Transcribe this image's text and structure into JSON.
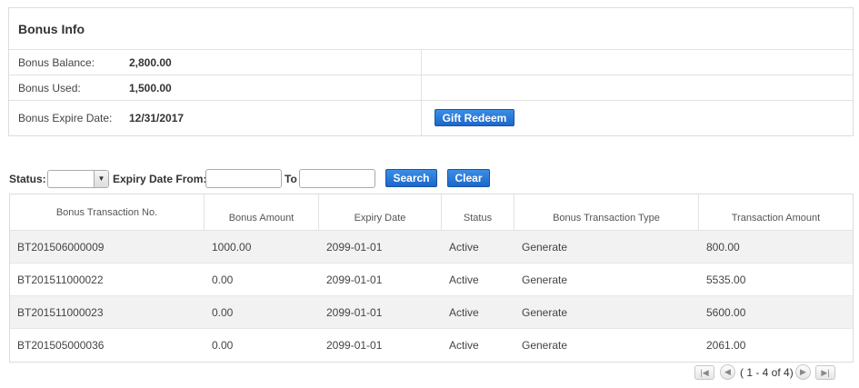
{
  "bonus_info": {
    "title": "Bonus Info",
    "balance_label": "Bonus Balance:",
    "balance_value": "2,800.00",
    "used_label": "Bonus Used:",
    "used_value": "1,500.00",
    "expire_label": "Bonus Expire Date:",
    "expire_value": "12/31/2017",
    "gift_redeem_label": "Gift Redeem"
  },
  "filter": {
    "status_label": "Status:",
    "status_selected": "",
    "expiry_from_label": "Expiry Date From:",
    "expiry_from_value": "",
    "to_label": "To",
    "to_value": "",
    "search_label": "Search",
    "clear_label": "Clear"
  },
  "table": {
    "headers": [
      "Bonus Transaction No.",
      "Bonus Amount",
      "Expiry Date",
      "Status",
      "Bonus Transaction Type",
      "Transaction Amount"
    ],
    "rows": [
      [
        "BT201506000009",
        "1000.00",
        "2099-01-01",
        "Active",
        "Generate",
        "800.00"
      ],
      [
        "BT201511000022",
        "0.00",
        "2099-01-01",
        "Active",
        "Generate",
        "5535.00"
      ],
      [
        "BT201511000023",
        "0.00",
        "2099-01-01",
        "Active",
        "Generate",
        "5600.00"
      ],
      [
        "BT201505000036",
        "0.00",
        "2099-01-01",
        "Active",
        "Generate",
        "2061.00"
      ]
    ]
  },
  "pager": {
    "text": "( 1 - 4 of 4)",
    "icons": [
      "first-page-icon",
      "prev-page-icon",
      "next-page-icon",
      "last-page-icon"
    ]
  },
  "colors": {
    "button_blue": "#1d67c9",
    "row_stripe": "#f2f2f2",
    "border": "#dcdcdc"
  }
}
